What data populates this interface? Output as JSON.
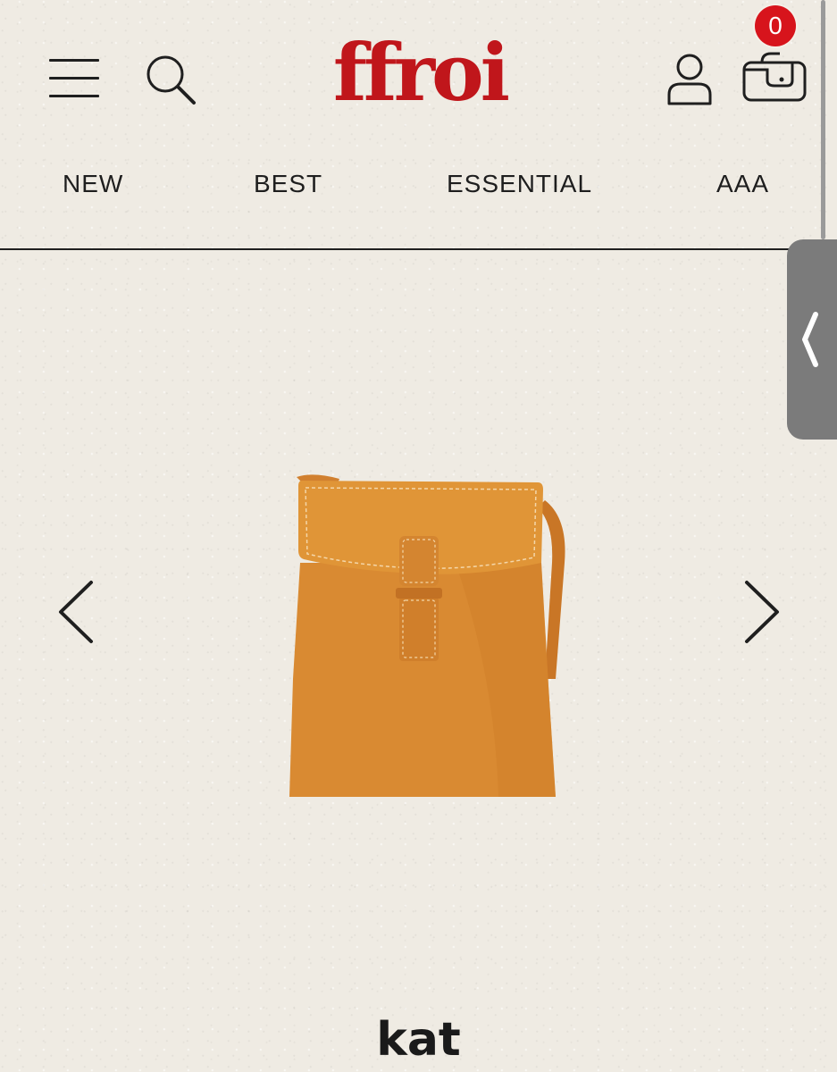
{
  "header": {
    "logo_text": "ffroi",
    "menu_icon": "hamburger-menu-icon",
    "search_icon": "search-icon",
    "user_icon": "user-icon",
    "cart_icon": "shopping-bag-icon",
    "cart_count": "0",
    "brand_color": "#c0161b",
    "badge_color": "#d7141c"
  },
  "nav": {
    "items": [
      {
        "label": "NEW"
      },
      {
        "label": "BEST"
      },
      {
        "label": "ESSENTIAL"
      },
      {
        "label": "AAA"
      }
    ]
  },
  "side_tab": {
    "icon": "chevron-left-icon"
  },
  "carousel": {
    "prev_icon": "chevron-left-icon",
    "next_icon": "chevron-right-icon",
    "product_name": "kat",
    "bag_color": "#d98a32"
  }
}
